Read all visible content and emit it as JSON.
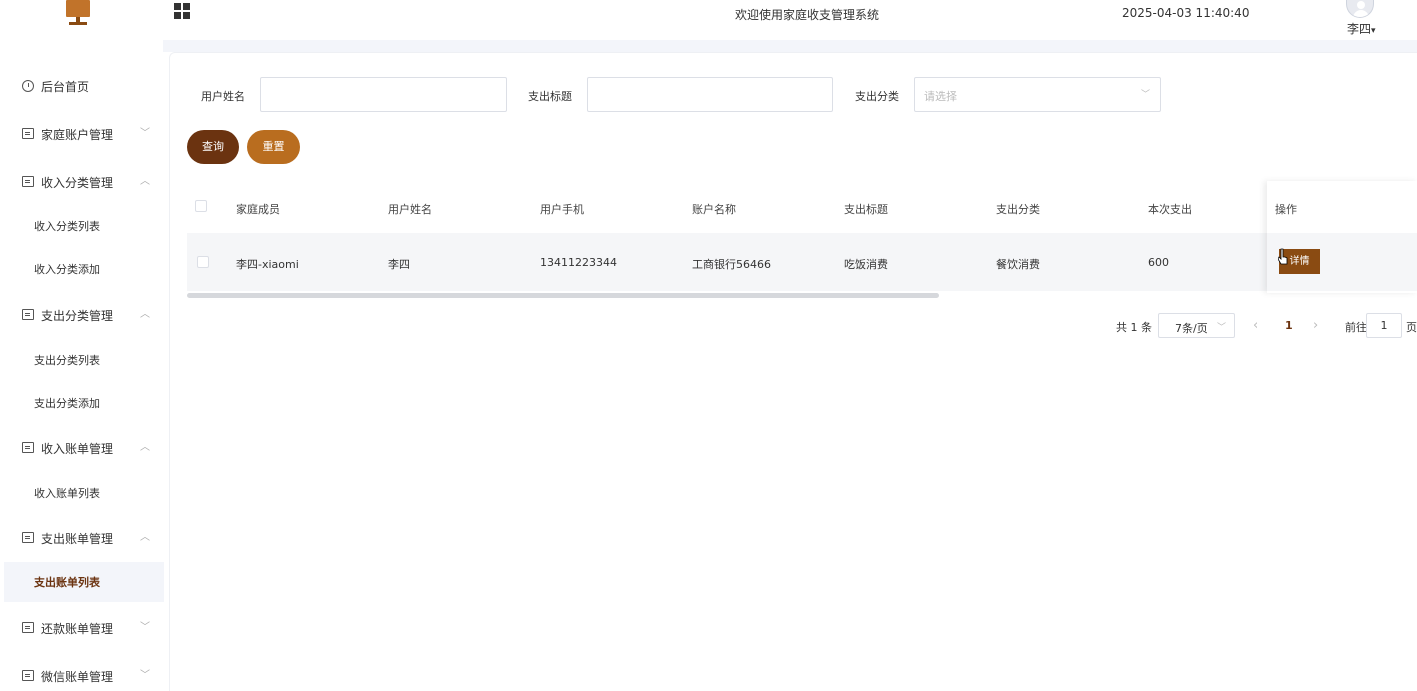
{
  "header": {
    "welcome": "欢迎使用家庭收支管理系统",
    "datetime": "2025-04-03 11:40:40",
    "user": "李四",
    "user_caret": "▾"
  },
  "sidebar": {
    "items": [
      {
        "label": "后台首页",
        "arrow": ""
      },
      {
        "label": "家庭账户管理",
        "arrow": "﹀"
      },
      {
        "label": "收入分类管理",
        "arrow": "︿"
      },
      {
        "label": "收入分类列表"
      },
      {
        "label": "收入分类添加"
      },
      {
        "label": "支出分类管理",
        "arrow": "︿"
      },
      {
        "label": "支出分类列表"
      },
      {
        "label": "支出分类添加"
      },
      {
        "label": "收入账单管理",
        "arrow": "︿"
      },
      {
        "label": "收入账单列表"
      },
      {
        "label": "支出账单管理",
        "arrow": "︿"
      },
      {
        "label": "支出账单列表"
      },
      {
        "label": "还款账单管理",
        "arrow": "﹀"
      },
      {
        "label": "微信账单管理",
        "arrow": "﹀"
      }
    ]
  },
  "filters": {
    "username_label": "用户姓名",
    "username_value": "",
    "title_label": "支出标题",
    "title_value": "",
    "category_label": "支出分类",
    "category_placeholder": "请选择",
    "query_button": "查询",
    "reset_button": "重置"
  },
  "table": {
    "columns": [
      "家庭成员",
      "用户姓名",
      "用户手机",
      "账户名称",
      "支出标题",
      "支出分类",
      "本次支出",
      "操作"
    ],
    "rows": [
      {
        "member": "李四-xiaomi",
        "username": "李四",
        "phone": "13411223344",
        "account": "工商银行56466",
        "title": "吃饭消费",
        "category": "餐饮消费",
        "amount": "600",
        "action": "详情"
      }
    ]
  },
  "pagination": {
    "total": "共 1 条",
    "page_size": "7条/页",
    "prev": "‹",
    "current": "1",
    "next": "›",
    "goto_label": "前往",
    "goto_value": "1",
    "goto_suffix": "页"
  }
}
